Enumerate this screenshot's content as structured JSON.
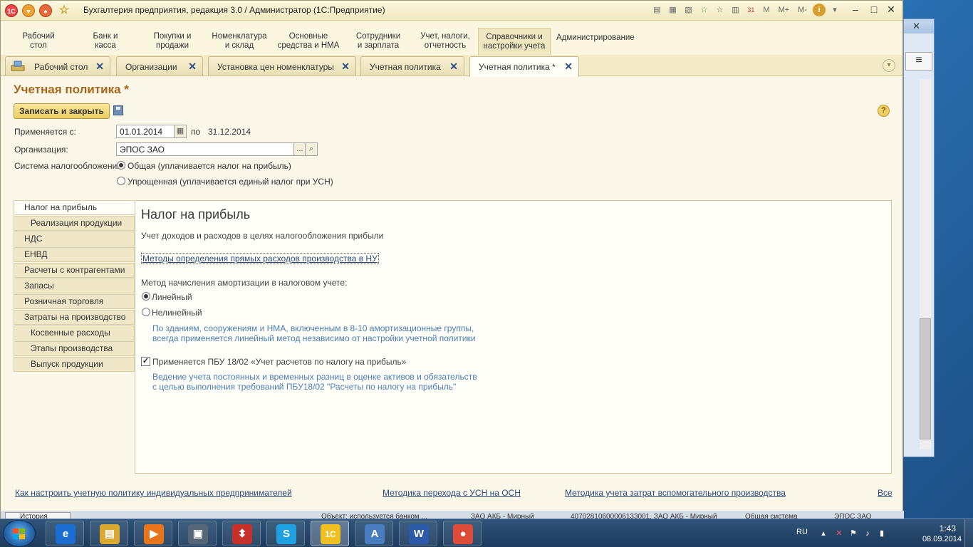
{
  "window": {
    "title": "Бухгалтерия предприятия, редакция 3.0 / Администратор  (1С:Предприятие)",
    "app_badge": "1С",
    "toolbar_tools": [
      "print-icon",
      "save-icon",
      "preview-icon",
      "favorite-add-icon",
      "favorite-icon",
      "calculator-icon",
      "calendar-icon"
    ],
    "calendar_day": "31",
    "memory_buttons": [
      "M",
      "M+",
      "M-"
    ],
    "info_label": "i"
  },
  "sections": [
    {
      "label": "Рабочий\nстол"
    },
    {
      "label": "Банк и\nкасса"
    },
    {
      "label": "Покупки и\nпродажи"
    },
    {
      "label": "Номенклатура\nи склад"
    },
    {
      "label": "Основные\nсредства и НМА"
    },
    {
      "label": "Сотрудники\nи зарплата"
    },
    {
      "label": "Учет, налоги,\nотчетность"
    },
    {
      "label": "Справочники и\nнастройки учета"
    },
    {
      "label": "Администрирование"
    }
  ],
  "tabs": [
    {
      "label": "Рабочий стол"
    },
    {
      "label": "Организации"
    },
    {
      "label": "Установка цен номенклатуры"
    },
    {
      "label": "Учетная политика"
    },
    {
      "label": "Учетная политика *"
    }
  ],
  "form": {
    "title": "Учетная политика *",
    "save_close": "Записать и закрыть",
    "help": "?",
    "applies_label": "Применяется с:",
    "date_from": "01.01.2014",
    "to_label": "по",
    "date_to": "31.12.2014",
    "org_label": "Организация:",
    "org_value": "ЭПОС ЗАО",
    "org_select": "...",
    "tax_label": "Система налогообложения:",
    "tax_general": "Общая (уплачивается налог на прибыль)",
    "tax_simplified": "Упрощенная (уплачивается единый налог при УСН)"
  },
  "nav": [
    {
      "label": "Налог на прибыль"
    },
    {
      "label": "Реализация продукции"
    },
    {
      "label": "НДС"
    },
    {
      "label": "ЕНВД"
    },
    {
      "label": "Расчеты с контрагентами"
    },
    {
      "label": "Запасы"
    },
    {
      "label": "Розничная торговля"
    },
    {
      "label": "Затраты на производство"
    },
    {
      "label": "Косвенные расходы"
    },
    {
      "label": "Этапы производства"
    },
    {
      "label": "Выпуск продукции"
    }
  ],
  "panel": {
    "title": "Налог на прибыль",
    "subtitle": "Учет доходов и расходов в целях налогообложения прибыли",
    "direct_costs_link": "Методы определения прямых расходов производства в НУ",
    "depr_label": "Метод начисления амортизации в налоговом учете:",
    "depr_linear": "Линейный",
    "depr_nonlinear": "Нелинейный",
    "depr_hint_1": "По зданиям, сооружениям и НМА, включенным в 8-10 амортизационные группы,",
    "depr_hint_2": "всегда применяется линейный метод независимо от настройки учетной политики",
    "pbu_label": "Применяется ПБУ 18/02 «Учет расчетов по налогу на прибыль»",
    "pbu_hint_1": "Ведение учета постоянных и временных разниц в оценке активов и обязательств",
    "pbu_hint_2": "с целью выполнения требований ПБУ18/02 \"Расчеты по налогу на прибыль\""
  },
  "bottom_links": {
    "ip_policy": "Как настроить учетную политику индивидуальных предпринимателей",
    "usn_to_osn": "Методика перехода с УСН на ОСН",
    "aux_production": "Методика учета затрат вспомогательного производства",
    "all": "Все"
  },
  "history": {
    "button": "История",
    "items": [
      "Объект: используется банком ...",
      "ЗАО АКБ - Мирный",
      "40702810600006133001, ЗАО АКБ - Мирный",
      "Общая система",
      "ЭПОС ЗАО"
    ]
  },
  "taskbar": {
    "apps": [
      {
        "name": "internet-explorer-icon",
        "glyph": "e",
        "color": "#1b6fd1"
      },
      {
        "name": "file-explorer-icon",
        "glyph": "▤",
        "color": "#d9a930"
      },
      {
        "name": "media-player-icon",
        "glyph": "▶",
        "color": "#e8741c"
      },
      {
        "name": "device-manager-icon",
        "glyph": "▣",
        "color": "#556677"
      },
      {
        "name": "remote-tool-icon",
        "glyph": "⬍",
        "color": "#c8302a"
      },
      {
        "name": "skype-icon",
        "glyph": "S",
        "color": "#1fa0e0"
      },
      {
        "name": "1c-icon",
        "glyph": "1С",
        "color": "#f0c020"
      },
      {
        "name": "text-editor-icon",
        "glyph": "A",
        "color": "#4a7cc0"
      },
      {
        "name": "word-icon",
        "glyph": "W",
        "color": "#2b5aa8"
      },
      {
        "name": "chrome-icon",
        "glyph": "●",
        "color": "#dd4b39"
      }
    ],
    "lang": "RU",
    "time": "1:43",
    "date": "08.09.2014"
  }
}
